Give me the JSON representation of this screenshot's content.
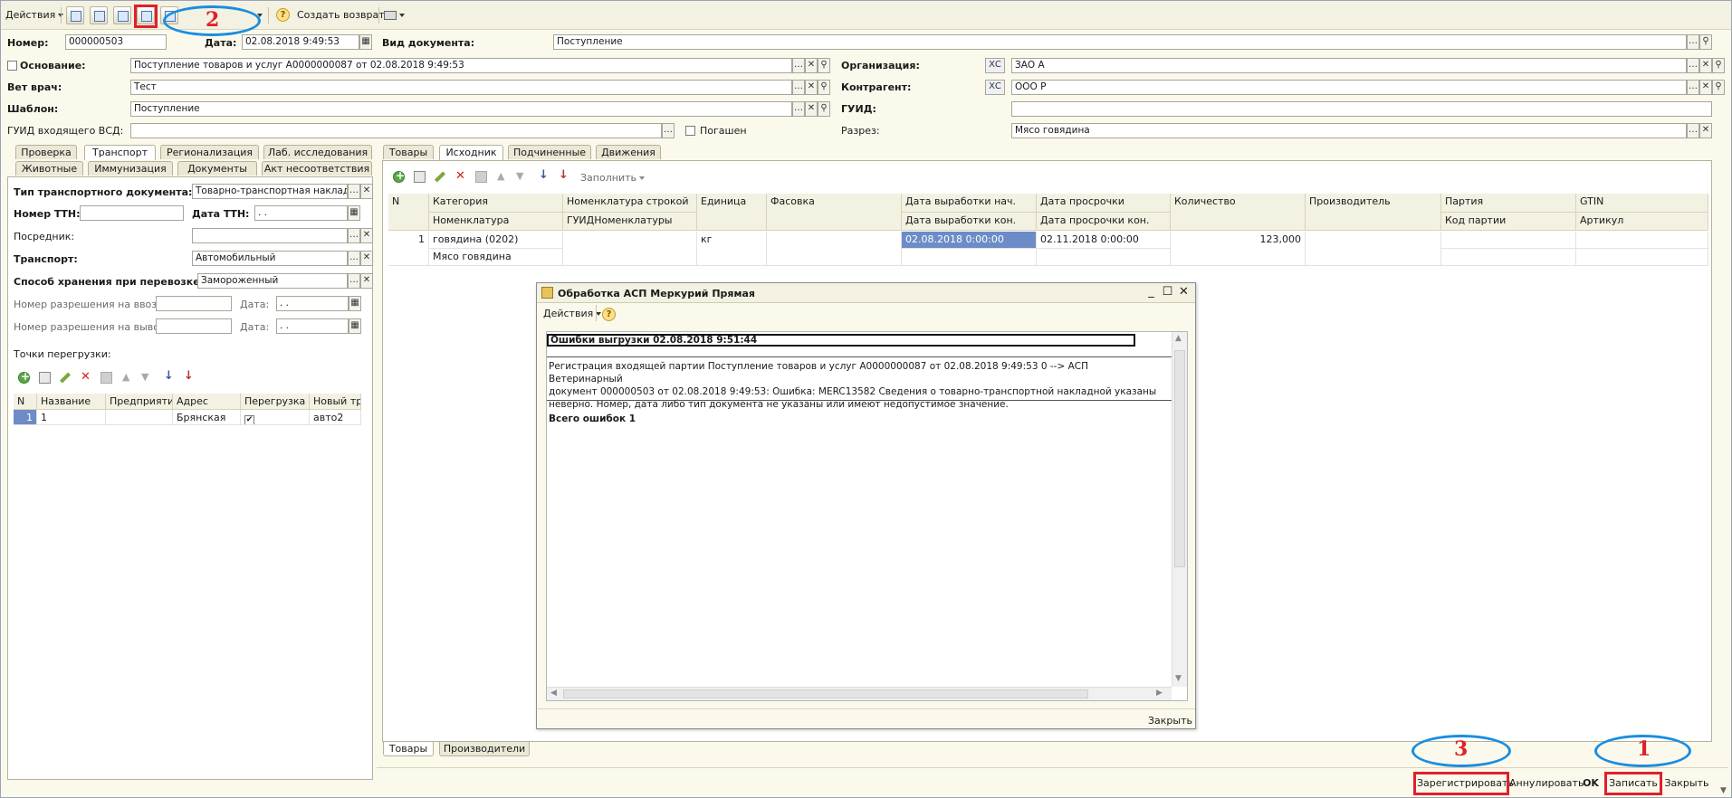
{
  "toolbar": {
    "actions": "Действия",
    "create_return": "Создать возврат"
  },
  "header": {
    "number_label": "Номер:",
    "number_value": "000000503",
    "date_label": "Дата:",
    "date_value": "02.08.2018  9:49:53",
    "doc_type_label": "Вид документа:",
    "doc_type_value": "Поступление",
    "basis_label": "Основание:",
    "basis_value": "Поступление товаров и услуг А0000000087 от 02.08.2018 9:49:53",
    "vet_label": "Вет врач:",
    "vet_value": "Тест",
    "template_label": "Шаблон:",
    "template_value": "Поступление",
    "guid_in_label": "ГУИД входящего ВСД:",
    "guid_in_value": "",
    "repaid_label": "Погашен",
    "org_label": "Организация:",
    "org_value": "ЗАО  А",
    "contractor_label": "Контрагент:",
    "contractor_value": "ООО Р",
    "guid_label": "ГУИД:",
    "guid_value": "",
    "cut_label": "Разрез:",
    "cut_value": "Мясо говядина",
    "xc": "ХС"
  },
  "left_tabs": {
    "row1": [
      "Проверка",
      "Транспорт",
      "Регионализация",
      "Лаб. исследования"
    ],
    "row2": [
      "Животные",
      "Иммунизация",
      "Документы",
      "Акт несоответствия"
    ]
  },
  "transport": {
    "doc_type_label": "Тип транспортного документа:",
    "doc_type_value": "Товарно-транспортная наклад",
    "ttn_num_label": "Номер ТТН:",
    "ttn_num_value": "",
    "ttn_date_label": "Дата ТТН:",
    "ttn_date_value": " .  .",
    "mediator_label": "Посредник:",
    "mediator_value": "",
    "transport_label": "Транспорт:",
    "transport_value": "Автомобильный",
    "storage_label": "Способ хранения при перевозке:",
    "storage_value": "Замороженный",
    "import_perm_label": "Номер разрешения на ввоз:",
    "export_perm_label": "Номер разрешения на вывоз:",
    "date_label": "Дата:",
    "date_empty": " .  .",
    "points_label": "Точки перегрузки:",
    "grid_headers": [
      "N",
      "Название",
      "Предприятие",
      "Адрес",
      "Перегрузка",
      "Новый тра"
    ],
    "grid_row": {
      "n": "1",
      "name": "1",
      "enterprise": "",
      "address": "Брянская",
      "reload": "✔",
      "new_transport": "авто2"
    }
  },
  "right_tabs": [
    "Товары",
    "Исходник",
    "Подчиненные",
    "Движения"
  ],
  "right_toolbar": {
    "fill": "Заполнить"
  },
  "goods_grid": {
    "headers_top": [
      "N",
      "Категория",
      "Номенклатура строкой",
      "Единица",
      "Фасовка",
      "Дата выработки нач.",
      "Дата просрочки",
      "Количество",
      "Производитель",
      "Партия",
      "GTIN"
    ],
    "headers_bottom": [
      "",
      "Номенклатура",
      "ГУИДНоменклатуры",
      "",
      "",
      "Дата выработки кон.",
      "Дата просрочки кон.",
      "",
      "",
      "Код партии",
      "Артикул"
    ],
    "row": {
      "n": "1",
      "category": "говядина (0202)",
      "nomenclature": "Мясо говядина",
      "unit": "кг",
      "prod_date_start": "02.08.2018 0:00:00",
      "expiry": "02.11.2018 0:00:00",
      "quantity": "123,000"
    }
  },
  "bottom_tabs": [
    "Товары",
    "Производители"
  ],
  "dialog": {
    "title": "Обработка  АСП Меркурий Прямая",
    "actions": "Действия",
    "report_header": "Ошибки выгрузки 02.08.2018 9:51:44",
    "message_lines": [
      "Регистрация входящей партии Поступление товаров и услуг А0000000087 от 02.08.2018 9:49:53 0 --> АСП Ветеринарный",
      "документ 000000503 от 02.08.2018 9:49:53: Ошибка: MERC13582 Сведения о товарно-транспортной накладной указаны",
      "неверно. Номер, дата либо тип документа не указаны или имеют недопустимое значение."
    ],
    "total": "Всего ошибок 1",
    "close": "Закрыть"
  },
  "bottom_bar": {
    "register": "Зарегистрировать",
    "annul": "Аннулировать",
    "ok": "OK",
    "save": "Записать",
    "close": "Закрыть"
  },
  "annotations": {
    "one": "1",
    "two": "2",
    "three": "3"
  },
  "colors": {
    "annotation_red": "#e0202a",
    "annotation_blue": "#1a8de0",
    "selection": "#6d8cc7"
  }
}
